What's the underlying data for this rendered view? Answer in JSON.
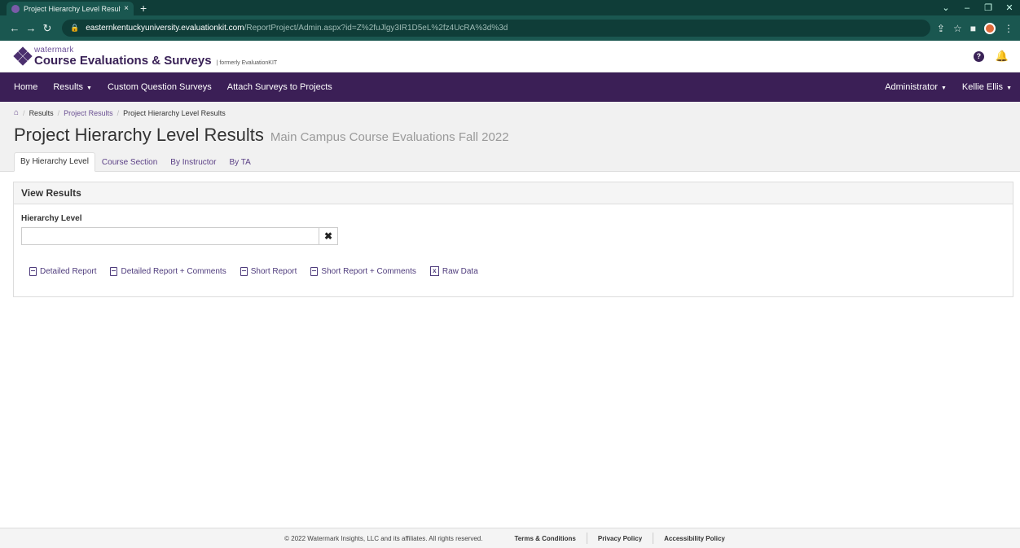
{
  "browser": {
    "tab_title": "Project Hierarchy Level Results >",
    "tab_close": "×",
    "new_tab": "+",
    "url_host": "easternkentuckyuniversity.evaluationkit.com",
    "url_path": "/ReportProject/Admin.aspx?id=Z%2fuJlgy3IR1D5eL%2fz4UcRA%3d%3d"
  },
  "app": {
    "brand_small": "watermark",
    "product": "Course Evaluations & Surveys",
    "formerly": "| formerly EvaluationKIT"
  },
  "nav": {
    "home": "Home",
    "results": "Results",
    "custom_surveys": "Custom Question Surveys",
    "attach": "Attach Surveys to Projects",
    "administrator": "Administrator",
    "user": "Kellie Ellis"
  },
  "breadcrumb": {
    "results": "Results",
    "project_results": "Project Results",
    "current": "Project Hierarchy Level Results"
  },
  "page": {
    "title": "Project Hierarchy Level Results",
    "subtitle": "Main Campus Course Evaluations Fall 2022"
  },
  "tabs": [
    "By Hierarchy Level",
    "Course Section",
    "By Instructor",
    "By TA"
  ],
  "panel": {
    "heading": "View Results",
    "field_label": "Hierarchy Level",
    "field_value": "",
    "clear": "✖"
  },
  "reports": [
    "Detailed Report",
    "Detailed Report + Comments",
    "Short Report",
    "Short Report + Comments",
    "Raw Data"
  ],
  "footer": {
    "copyright": "© 2022 Watermark Insights, LLC and its affiliates. All rights reserved.",
    "terms": "Terms & Conditions",
    "privacy": "Privacy Policy",
    "accessibility": "Accessibility Policy"
  },
  "colors": {
    "nav_bg": "#3b1f56",
    "link": "#6a4f92",
    "browser_frame": "#1a5750"
  }
}
